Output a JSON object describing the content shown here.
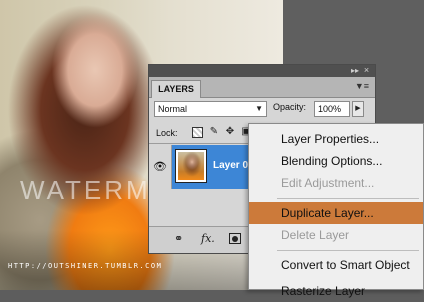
{
  "photo": {
    "watermark": "WATERMA",
    "url": "HTTP://OUTSHINER.TUMBLR.COM"
  },
  "panel": {
    "tab_label": "LAYERS",
    "collapse_icon": "double-chevron-right-icon",
    "close_icon": "close-icon",
    "menu_icon": "panel-menu-icon",
    "blend_mode": "Normal",
    "opacity_label": "Opacity:",
    "opacity_value": "100%",
    "lock_label": "Lock:",
    "layer": {
      "name": "Layer 0",
      "visible": true
    },
    "footer_icons": [
      "link-layers-icon",
      "fx-icon",
      "add-mask-icon"
    ]
  },
  "context_menu": {
    "items": [
      {
        "label": "Layer Properties...",
        "enabled": true
      },
      {
        "label": "Blending Options...",
        "enabled": true
      },
      {
        "label": "Edit Adjustment...",
        "enabled": false
      },
      {
        "label": "Duplicate Layer...",
        "enabled": true,
        "selected": true
      },
      {
        "label": "Delete Layer",
        "enabled": false
      },
      {
        "label": "Convert to Smart Object",
        "enabled": true
      },
      {
        "label": "Rasterize Layer",
        "enabled": true
      }
    ],
    "highlight_color": "#cc7a3a"
  },
  "colors": {
    "selected_layer": "#3d86d6",
    "panel_bg": "#d6d6d6"
  }
}
